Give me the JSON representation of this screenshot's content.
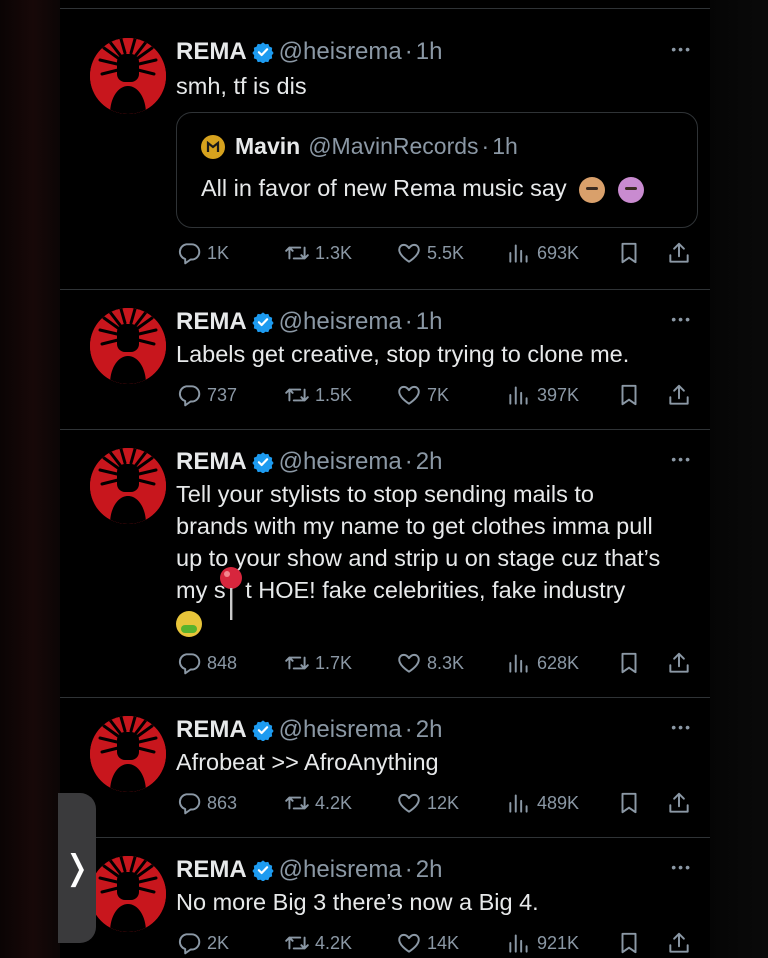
{
  "tweets": [
    {
      "name": "REMA",
      "handle": "@heisrema",
      "time": "1h",
      "text": "smh, tf is dis",
      "quote": {
        "name": "Mavin",
        "handle": "@MavinRecords",
        "time": "1h",
        "text": "All in favor of new Rema music say"
      },
      "stats": {
        "replies": "1K",
        "retweets": "1.3K",
        "likes": "5.5K",
        "views": "693K"
      }
    },
    {
      "name": "REMA",
      "handle": "@heisrema",
      "time": "1h",
      "text": "Labels get creative, stop trying to clone me.",
      "stats": {
        "replies": "737",
        "retweets": "1.5K",
        "likes": "7K",
        "views": "397K"
      }
    },
    {
      "name": "REMA",
      "handle": "@heisrema",
      "time": "2h",
      "lines": [
        "Tell your stylists to stop sending mails to",
        "brands with my name to get clothes imma pull",
        "up to your show and strip u on stage cuz that’s",
        "my s   t HOE! fake celebrities, fake industry"
      ],
      "stats": {
        "replies": "848",
        "retweets": "1.7K",
        "likes": "8.3K",
        "views": "628K"
      }
    },
    {
      "name": "REMA",
      "handle": "@heisrema",
      "time": "2h",
      "text": "Afrobeat >> AfroAnything",
      "stats": {
        "replies": "863",
        "retweets": "4.2K",
        "likes": "12K",
        "views": "489K"
      }
    },
    {
      "name": "REMA",
      "handle": "@heisrema",
      "time": "2h",
      "text": "No more Big 3 there’s now a Big 4.",
      "stats": {
        "replies": "2K",
        "retweets": "4.2K",
        "likes": "14K",
        "views": "921K"
      }
    }
  ],
  "side_tab": {
    "label": "❭"
  },
  "icons": [
    "verified-badge-icon",
    "more-icon",
    "reply-icon",
    "retweet-icon",
    "like-icon",
    "views-icon",
    "bookmark-icon",
    "share-icon"
  ],
  "colors": {
    "background": "#000000",
    "text": "#e7e9ea",
    "secondary": "#8b98a5",
    "divider": "#2f3336",
    "verified": "#1d9bf0",
    "avatar": "#c8161d"
  }
}
